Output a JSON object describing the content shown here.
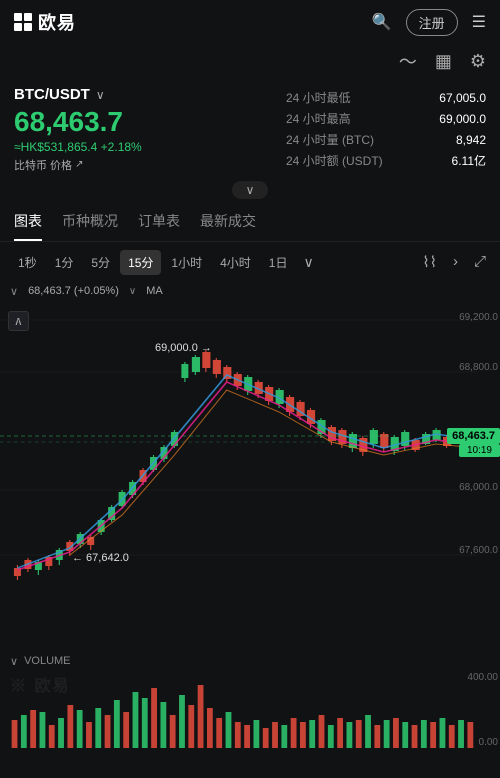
{
  "app": {
    "logo_text": "欧易",
    "logo_icon": "grid-icon"
  },
  "nav": {
    "search_label": "🔍",
    "register_label": "注册",
    "menu_label": "☰"
  },
  "secondary_nav": {
    "wave_icon": "wave-icon",
    "list_icon": "list-icon",
    "settings_icon": "settings-icon"
  },
  "pair": {
    "name": "BTC/USDT",
    "arrow": "∨"
  },
  "price": {
    "main": "68,463.7",
    "hk": "≈HK$531,865.4",
    "change": "+2.18%",
    "btc_label": "比特币 价格"
  },
  "stats": [
    {
      "label": "24 小时最低",
      "value": "67,005.0"
    },
    {
      "label": "24 小时最高",
      "value": "69,000.0"
    },
    {
      "label": "24 小时量 (BTC)",
      "value": "8,942"
    },
    {
      "label": "24 小时额 (USDT)",
      "value": "6.11亿"
    }
  ],
  "tabs": [
    {
      "label": "图表",
      "active": true
    },
    {
      "label": "币种概况",
      "active": false
    },
    {
      "label": "订单表",
      "active": false
    },
    {
      "label": "最新成交",
      "active": false
    }
  ],
  "timeframes": [
    {
      "label": "1秒",
      "active": false
    },
    {
      "label": "1分",
      "active": false
    },
    {
      "label": "5分",
      "active": false
    },
    {
      "label": "15分",
      "active": true
    },
    {
      "label": "1小时",
      "active": false
    },
    {
      "label": "4小时",
      "active": false
    },
    {
      "label": "1日",
      "active": false
    }
  ],
  "chart": {
    "info_price": "68,463.7 (+0.05%)",
    "info_ma": "MA",
    "high_label": "69,000.0",
    "low_label": "67,642.0",
    "current_price": "68,463.7",
    "current_time": "10:19",
    "price_labels": [
      "69,200.0",
      "68,800.0",
      "68,463.7",
      "68,000.0",
      "67,600.0"
    ]
  },
  "volume": {
    "header": "VOLUME",
    "labels": [
      "400.00",
      "0.00"
    ]
  },
  "watermark": "※ 欧易"
}
